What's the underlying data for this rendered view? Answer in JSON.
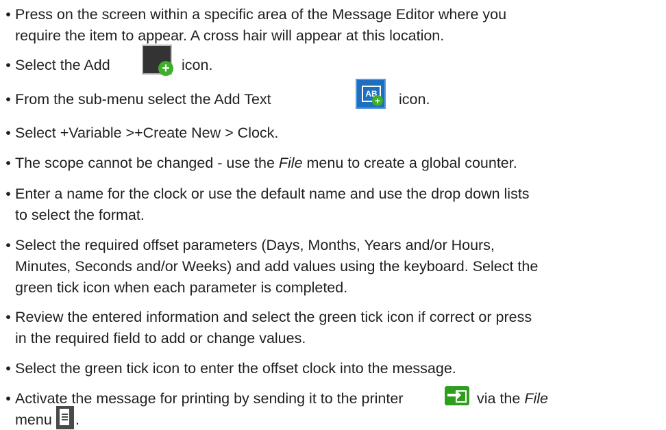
{
  "bullet_char": "•",
  "items": [
    {
      "line1": "Press on the screen within a specific area of the Message Editor where you",
      "line2": "require the item to appear. A cross hair will appear at this location."
    },
    {
      "before": "Select the Add",
      "after": "icon.",
      "icon": "add-item-icon"
    },
    {
      "before": "From the sub-menu select the Add Text",
      "after": "icon.",
      "icon": "add-text-icon",
      "icon_text": "AB"
    },
    {
      "text": "Select +Variable >+Create New > Clock."
    },
    {
      "before": "The scope cannot be changed - use the ",
      "italic": "File",
      "after": " menu to create a global counter."
    },
    {
      "line1": "Enter a name for the clock or use the default name and use the drop down lists",
      "line2": "to select the format."
    },
    {
      "line1": "Select the required offset parameters (Days, Months, Years and/or Hours,",
      "line2": "Minutes, Seconds and/or Weeks) and add values using the keyboard. Select the",
      "line3": "green tick icon when each parameter is completed."
    },
    {
      "line1": "Review the entered information and select the green tick icon if correct or press",
      "line2": "in the required field to add or change values."
    },
    {
      "text": "Select the green tick icon to enter the offset clock into the message."
    },
    {
      "before": "Activate the message for printing by sending it to the printer",
      "icon": "send-to-printer-icon",
      "mid": "via the ",
      "italic": "File",
      "line2": "menu",
      "icon2": "file-menu-icon",
      "end": "."
    }
  ]
}
